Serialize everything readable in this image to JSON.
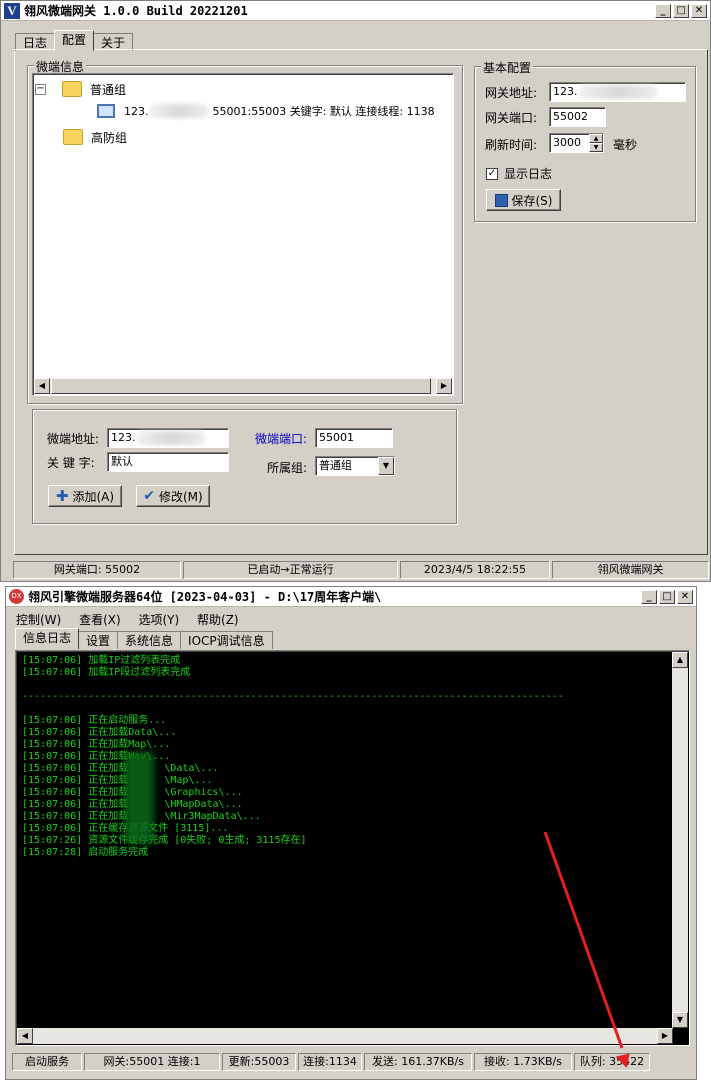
{
  "gateway": {
    "title": "翎风微端网关 1.0.0 Build 20221201",
    "tabs": [
      "日志",
      "配置",
      "关于"
    ],
    "micro_info": {
      "legend": "微端信息",
      "tree": {
        "group1": "普通组",
        "server_prefix": "123.",
        "server_suffix": "55001:55003 关键字: 默认 连接线程: 1138",
        "group2": "高防组"
      },
      "address_label": "微端地址:",
      "address_value": "123.",
      "port_label": "微端端口:",
      "port_value": "55001",
      "keyword_label": "关 键 字:",
      "keyword_value": "默认",
      "group_label": "所属组:",
      "group_value": "普通组",
      "add_button": "添加(A)",
      "modify_button": "修改(M)"
    },
    "basic_config": {
      "legend": "基本配置",
      "address_label": "网关地址:",
      "address_value": "123.",
      "port_label": "网关端口:",
      "port_value": "55002",
      "refresh_label": "刷新时间:",
      "refresh_value": "3000",
      "refresh_unit": "毫秒",
      "show_log_label": "显示日志",
      "show_log_checked": true,
      "save_button": "保存(S)"
    },
    "status": [
      "网关端口: 55002",
      "已启动→正常运行",
      "2023/4/5 18:22:55",
      "翎风微端网关"
    ]
  },
  "server": {
    "title": "翎风引擎微端服务器64位 [2023-04-03] - D:\\17周年客户端\\",
    "menu": [
      "控制(W)",
      "查看(X)",
      "选项(Y)",
      "帮助(Z)"
    ],
    "tabs": [
      "信息日志",
      "设置",
      "系统信息",
      "IOCP调试信息"
    ],
    "log": [
      "[15:07:06] 加载IP过滤列表完成",
      "[15:07:06] 加载IP段过滤列表完成",
      "",
      "------------------------------------------------------------------------------------------",
      "",
      "[15:07:06] 正在启动服务...",
      "[15:07:06] 正在加载Data\\...",
      "[15:07:06] 正在加载Map\\...",
      "[15:07:06] 正在加载Wav\\...",
      "[15:07:06] 正在加载      \\Data\\...",
      "[15:07:06] 正在加载      \\Map\\...",
      "[15:07:06] 正在加载      \\Graphics\\...",
      "[15:07:06] 正在加载      \\HMapData\\...",
      "[15:07:06] 正在加载      \\Mir3MapData\\...",
      "[15:07:06] 正在缓存资源文件 [3115]...",
      "[15:07:26] 资源文件缓存完成 [0失败; 0生成; 3115存在]",
      "[15:07:28] 启动服务完成"
    ],
    "status": [
      "启动服务",
      "网关:55001 连接:1",
      "更新:55003",
      "连接:1134",
      "发送: 161.37KB/s",
      "接收: 1.73KB/s",
      "队列: 35422"
    ]
  },
  "colors": {
    "console_bg": "#000000",
    "console_text": "#19d319",
    "annotation_arrow": "#e02020",
    "port_label_blue": "#0000c0"
  }
}
